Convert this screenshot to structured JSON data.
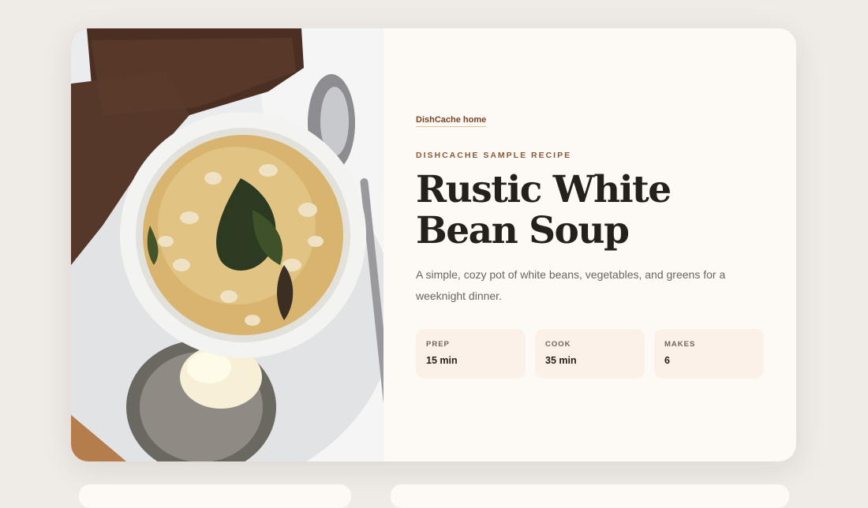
{
  "nav": {
    "home_link": "DishCache home"
  },
  "recipe": {
    "eyebrow": "DISHCACHE SAMPLE RECIPE",
    "title": "Rustic White Bean Soup",
    "description": "A simple, cozy pot of white beans, vegetables, and greens for a weeknight dinner.",
    "stats": [
      {
        "label": "PREP",
        "value": "15 min"
      },
      {
        "label": "COOK",
        "value": "35 min"
      },
      {
        "label": "MAKES",
        "value": "6"
      }
    ]
  },
  "colors": {
    "page_bg": "#efebe7",
    "card_bg": "#fdfaf6",
    "accent": "#7a4326",
    "stat_bg": "#fcf1e8",
    "heading": "#26201b"
  }
}
